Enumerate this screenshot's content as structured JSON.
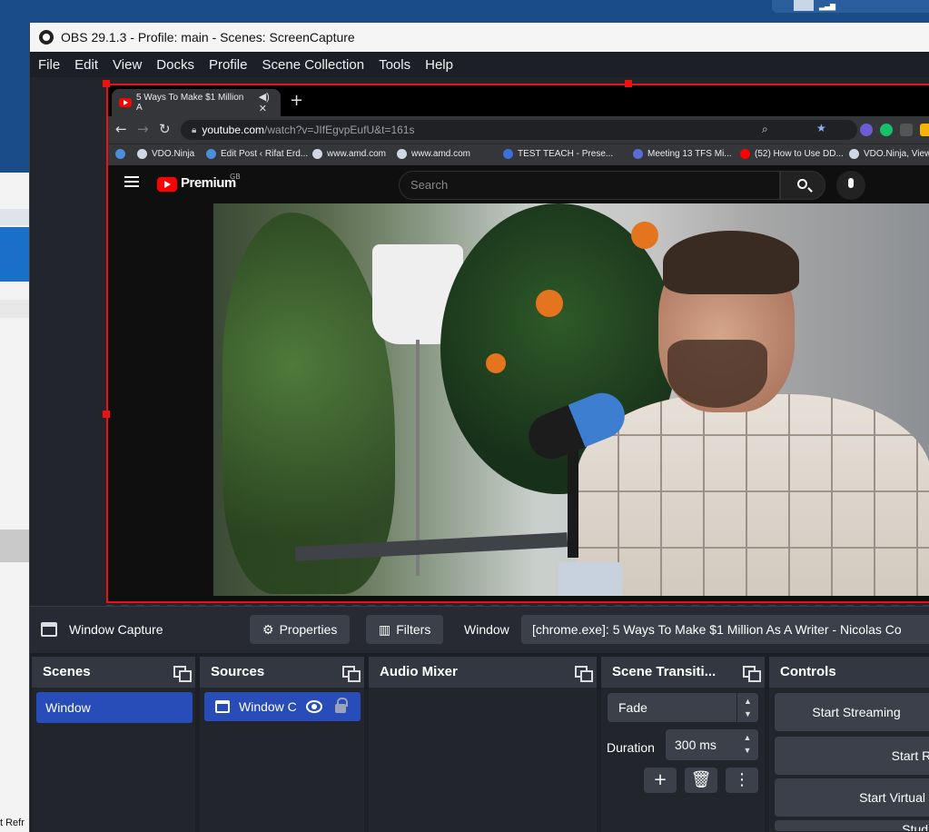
{
  "window": {
    "title": "OBS 29.1.3 - Profile: main - Scenes: ScreenCapture"
  },
  "menu": [
    "File",
    "Edit",
    "View",
    "Docks",
    "Profile",
    "Scene Collection",
    "Tools",
    "Help"
  ],
  "browser": {
    "tab_title": "5 Ways To Make $1 Million A",
    "url_host": "youtube.com",
    "url_path": "/watch?v=JIfEgvpEufU&t=161s",
    "bookmarks": [
      "VDO.Ninja",
      "Edit Post ‹ Rifat Erd...",
      "www.amd.com",
      "www.amd.com",
      "TEST TEACH - Prese...",
      "Meeting 13 TFS Mi...",
      "(52) How to Use DD...",
      "VDO.Ninja, View="
    ],
    "yt_brand": "Premium",
    "yt_region": "GB",
    "search_placeholder": "Search"
  },
  "context_bar": {
    "source_name": "Window Capture",
    "properties_label": "Properties",
    "filters_label": "Filters",
    "window_label": "Window",
    "window_value": "[chrome.exe]: 5 Ways To Make $1 Million As A Writer - Nicolas Co"
  },
  "docks": {
    "scenes": {
      "title": "Scenes",
      "items": [
        "Window"
      ]
    },
    "sources": {
      "title": "Sources",
      "items": [
        "Window C"
      ]
    },
    "audio_mixer": {
      "title": "Audio Mixer"
    },
    "transitions": {
      "title": "Scene Transiti...",
      "selected": "Fade",
      "duration_label": "Duration",
      "duration_value": "300 ms"
    },
    "controls": {
      "title": "Controls",
      "buttons": [
        "Start Streaming",
        "Start Re",
        "Start Virtual C",
        "Studio"
      ]
    }
  },
  "desktop": {
    "bg_label": "t Refr"
  }
}
